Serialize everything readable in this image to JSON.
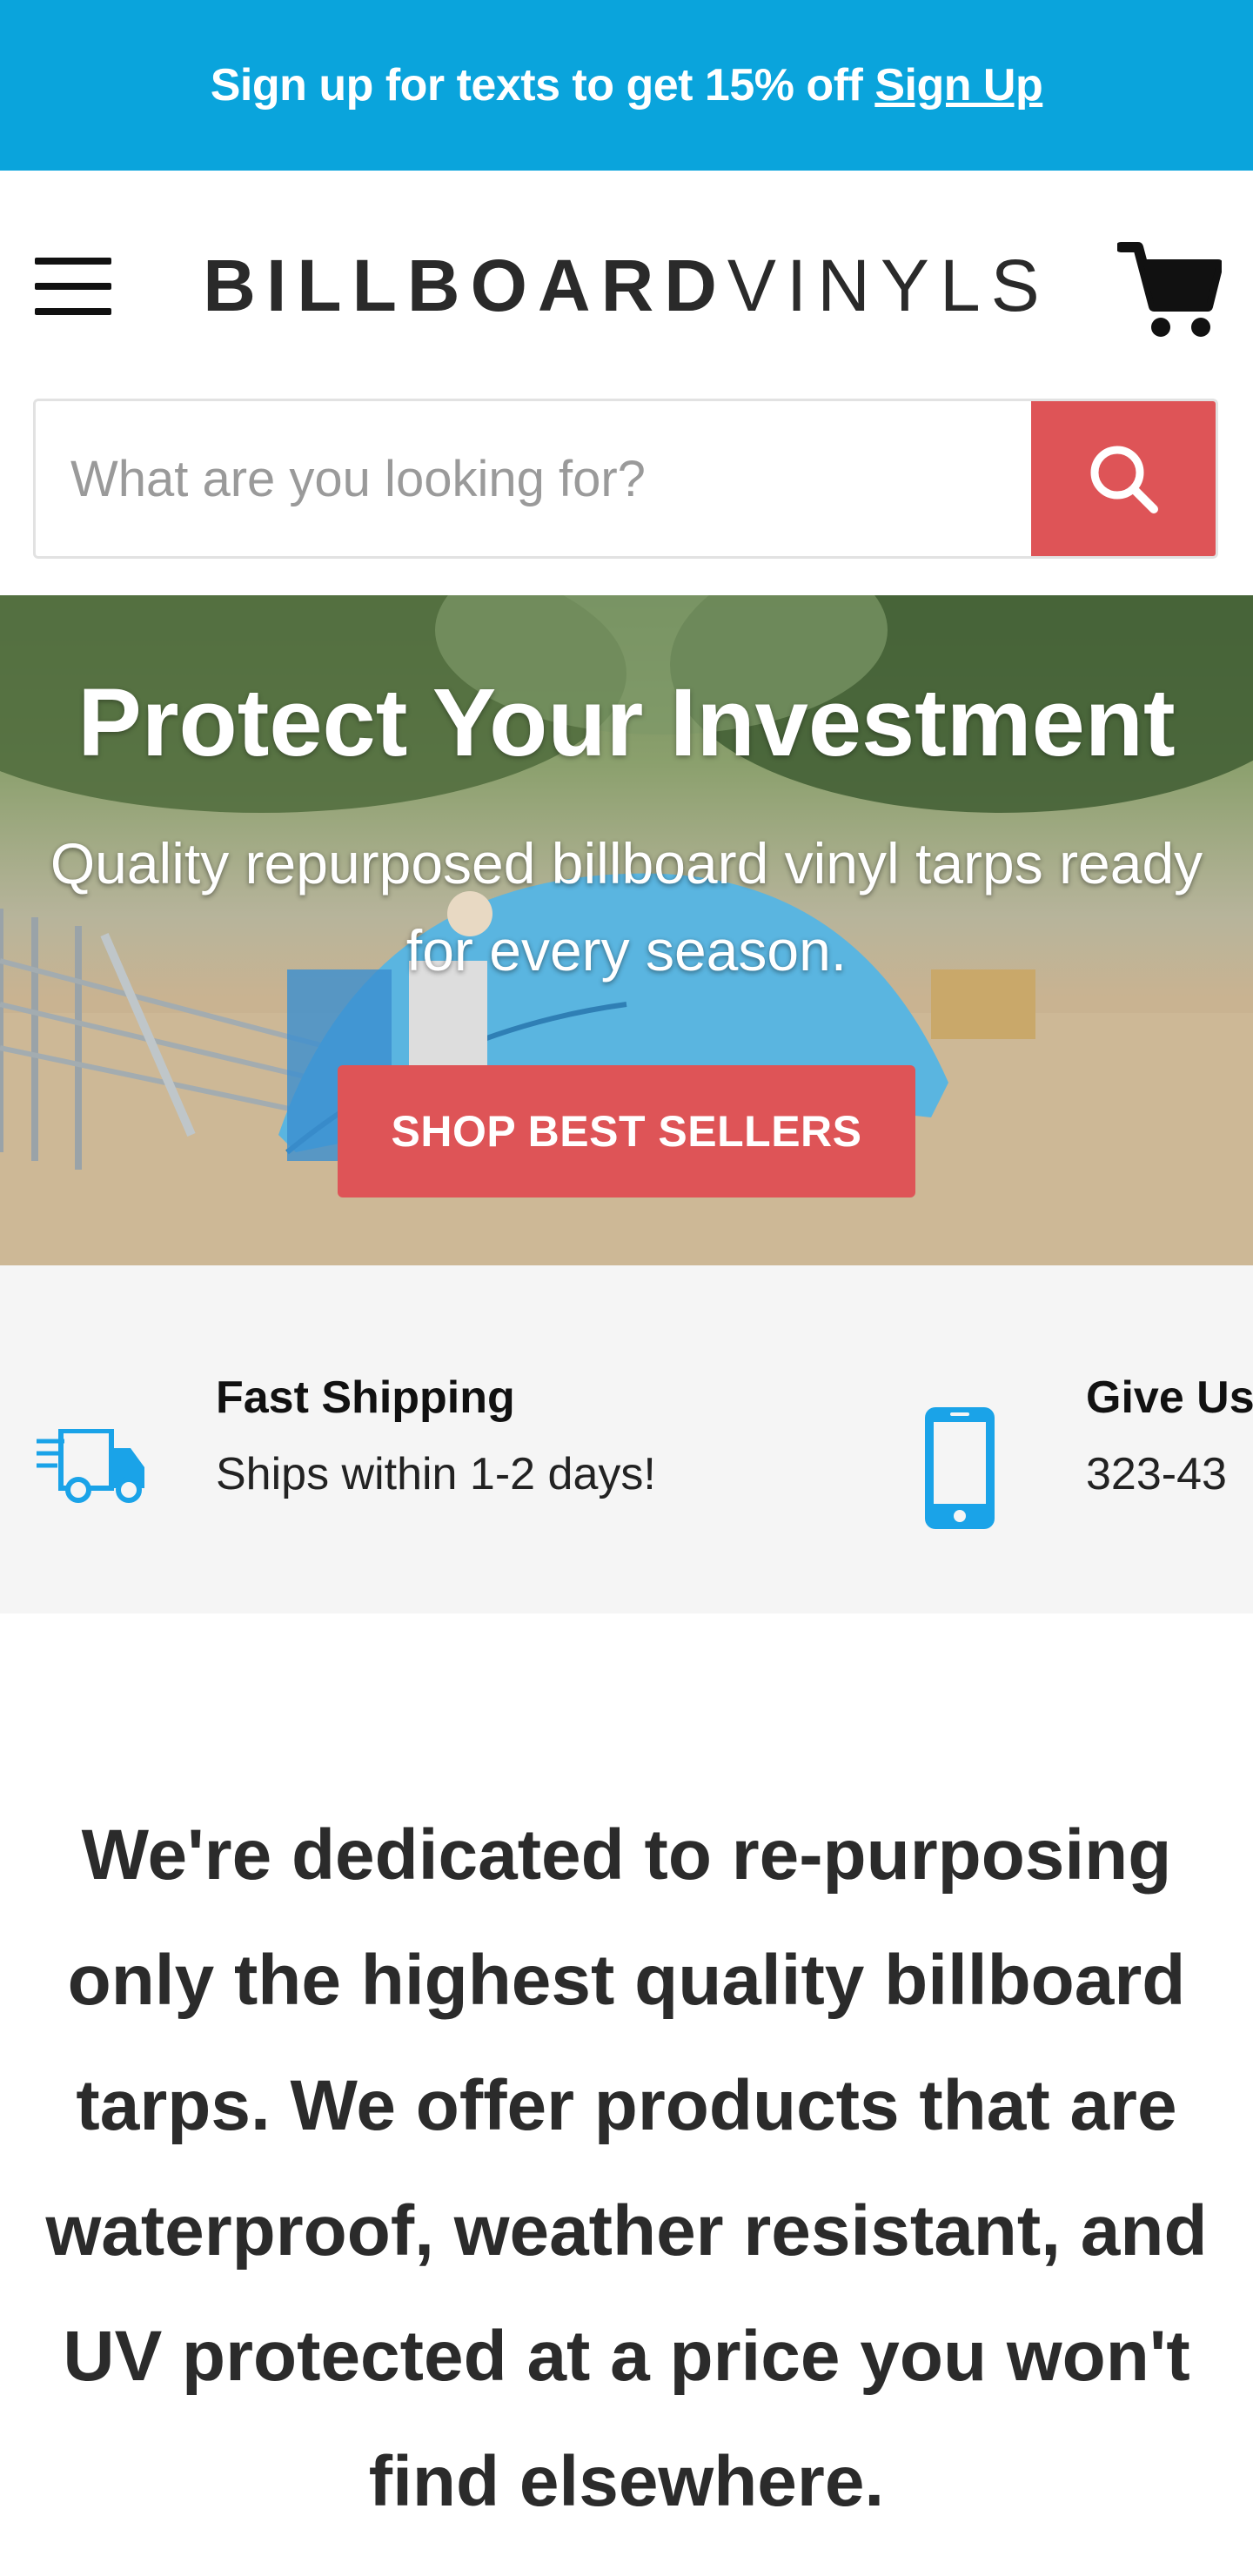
{
  "promo": {
    "text": "Sign up for texts to get 15% off",
    "link": "Sign Up"
  },
  "header": {
    "logo_bold": "BILLBOARD",
    "logo_light": "VINYLS",
    "menu_icon": "hamburger-menu-icon",
    "cart_icon": "shopping-cart-icon"
  },
  "search": {
    "placeholder": "What are you looking for?",
    "value": "",
    "button_icon": "search-icon"
  },
  "hero": {
    "title": "Protect Your Investment",
    "subtitle": "Quality repurposed billboard vinyl tarps ready for every season.",
    "button": "SHOP BEST SELLERS"
  },
  "features": [
    {
      "icon": "delivery-truck-icon",
      "title": "Fast Shipping",
      "text": "Ships within 1-2 days!"
    },
    {
      "icon": "mobile-phone-icon",
      "title": "Give Us",
      "text": "323-43"
    }
  ],
  "mission": {
    "text": "We're dedicated to re-purposing only the highest quality billboard tarps. We offer products that are waterproof, weather resistant, and UV protected at a price you won't find elsewhere."
  },
  "colors": {
    "promo_bg": "#0aa4dc",
    "accent_red": "#de5457",
    "icon_blue": "#1aa3e8",
    "features_bg": "#f5f5f5"
  }
}
